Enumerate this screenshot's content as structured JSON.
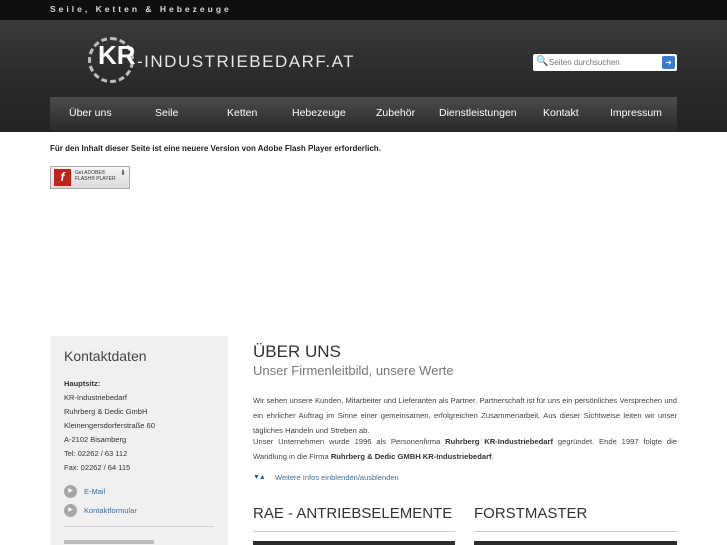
{
  "topbar": {
    "tagline": "Seile, Ketten & Hebezeuge"
  },
  "logo": {
    "kr": "KR",
    "rest": "-INDUSTRIEBEDARF.AT"
  },
  "search": {
    "placeholder": "Seiten durchsuchen",
    "icon": "search-icon",
    "button_icon": "arrow-right-icon"
  },
  "nav": {
    "items": [
      {
        "label": "Über uns"
      },
      {
        "label": "Seile"
      },
      {
        "label": "Ketten"
      },
      {
        "label": "Hebezeuge"
      },
      {
        "label": "Zubehör"
      },
      {
        "label": "Dienstleistungen"
      },
      {
        "label": "Kontakt"
      },
      {
        "label": "Impressum"
      }
    ]
  },
  "flash": {
    "message": "Für den Inhalt dieser Seite ist eine neuere Version von Adobe Flash Player erforderlich.",
    "badge_line1": "Get ADOBE®",
    "badge_line2": "FLASH® PLAYER"
  },
  "sidebar": {
    "title": "Kontaktdaten",
    "hauptsitz": "Hauptsitz:",
    "lines": [
      "KR-Industriebedarf",
      "Ruhrberg & Dedic GmbH",
      "Kleinengersdorferstraße 60",
      "A-2102 Bisamberg",
      "Tel: 02262 / 63 112",
      "Fax: 02262 / 64 115"
    ],
    "links": [
      {
        "label": "E-Mail"
      },
      {
        "label": "Kontaktformular"
      }
    ]
  },
  "main": {
    "title": "ÜBER UNS",
    "subtitle": "Unser Firmenleitbild, unsere Werte",
    "p1": "Wir sehen unsere Kunden, Mitarbeiter und Lieferanten als Partner. Partnerschaft ist für uns ein persönliches Versprechen und ein ehrlicher Auftrag im Sinne einer gemeinsamen, erfolgreichen Zusammenarbeit. Aus dieser Sichtweise leiten wir unser tägliches Handeln und Streben ab.",
    "p2_a": "Unser Unternehmen wurde 1996 als Personenfirma ",
    "p2_b": "Ruhrberg KR-Industriebedarf",
    "p2_c": " gegründet. Ende 1997 folgte die Wandlung in die Firma ",
    "p2_d": "Ruhrberg & Dedic GMBH KR-Industriebedarf",
    "p2_e": ".",
    "toggle_label": "Weitere Infos einblenden/ausblenden"
  },
  "boxes": [
    {
      "title": "RAE - ANTRIEBSELEMENTE"
    },
    {
      "title": "FORSTMASTER"
    }
  ]
}
